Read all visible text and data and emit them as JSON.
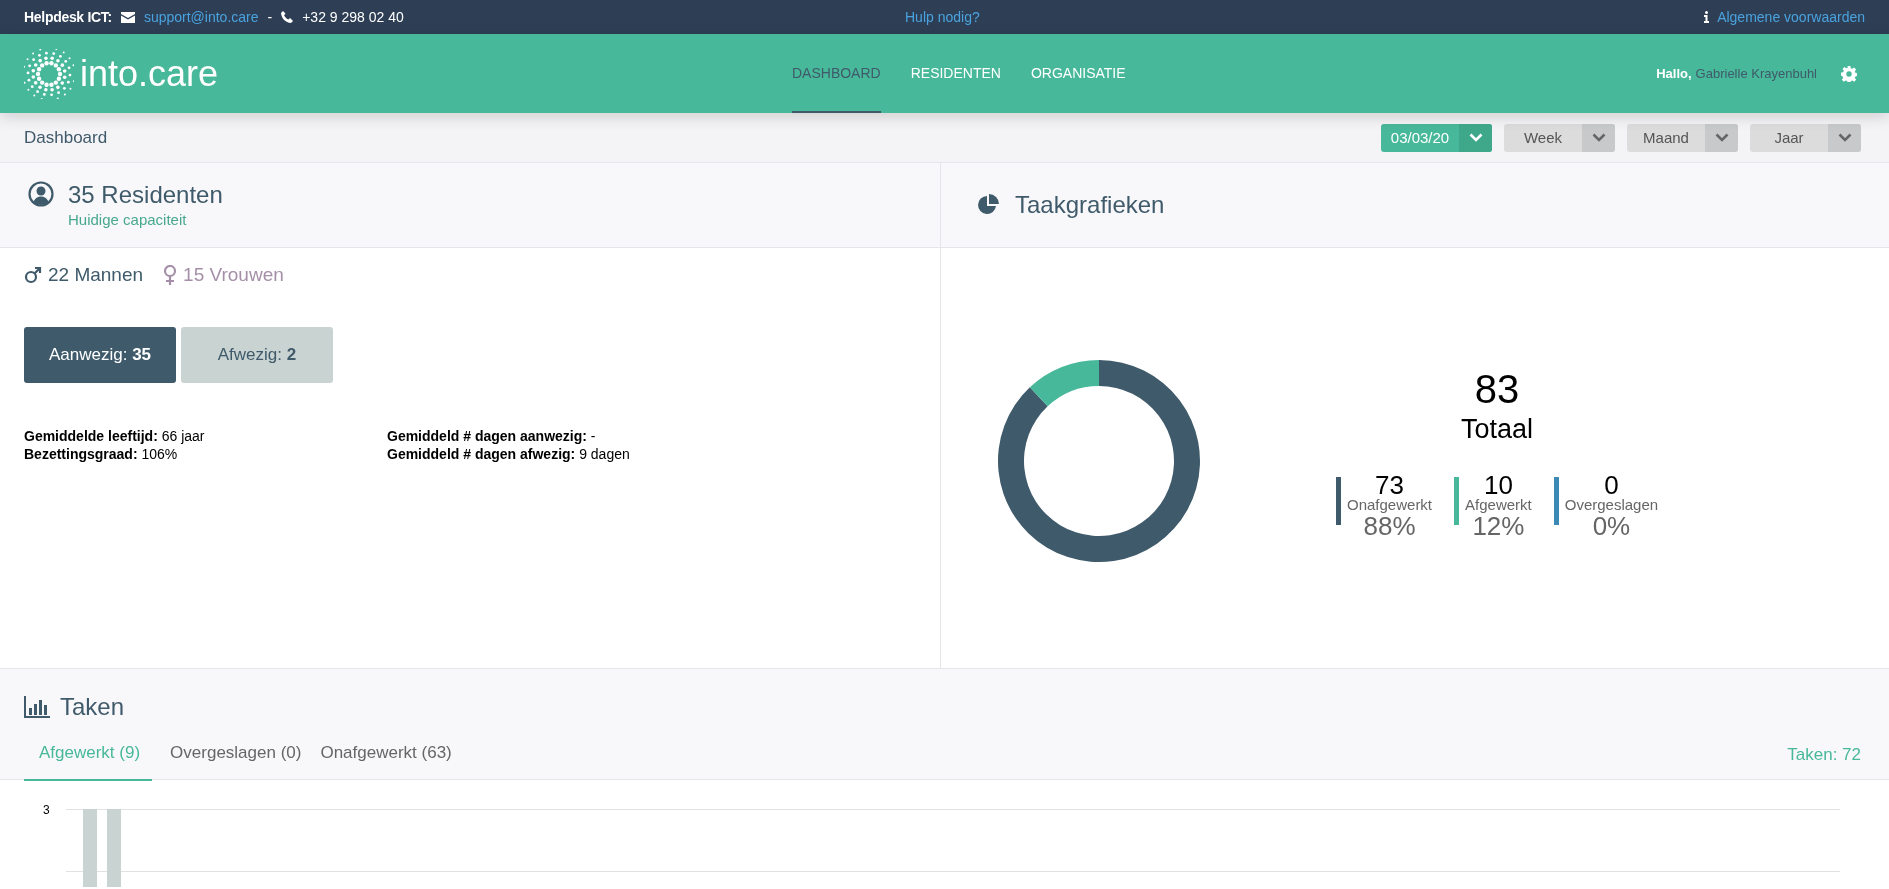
{
  "top_bar": {
    "helpdesk_label": "Helpdesk ICT:",
    "email": "support@into.care",
    "separator": "-",
    "phone": "+32 9 298 02 40",
    "help_link": "Hulp nodig?",
    "terms_link": "Algemene voorwaarden"
  },
  "header": {
    "logo_text": "into.care",
    "nav": [
      {
        "label": "DASHBOARD",
        "selected": true
      },
      {
        "label": "RESIDENTEN",
        "selected": false
      },
      {
        "label": "ORGANISATIE",
        "selected": false
      }
    ],
    "greeting": "Hallo,",
    "user_name": "Gabrielle Krayenbuhl"
  },
  "breadcrumb": "Dashboard",
  "period_selectors": [
    {
      "label": "03/03/20",
      "selected": true
    },
    {
      "label": "Week",
      "selected": false
    },
    {
      "label": "Maand",
      "selected": false
    },
    {
      "label": "Jaar",
      "selected": false
    }
  ],
  "residents": {
    "title": "35 Residenten",
    "subtitle": "Huidige capaciteit",
    "men": "22 Mannen",
    "women": "15 Vrouwen",
    "presence_buttons": [
      {
        "label": "Aanwezig:",
        "count": "35",
        "selected": true
      },
      {
        "label": "Afwezig:",
        "count": "2",
        "selected": false
      }
    ],
    "stats": [
      {
        "label": "Gemiddelde leeftijd:",
        "value": "66 jaar"
      },
      {
        "label": "Bezettingsgraad:",
        "value": "106%"
      },
      {
        "label": "Gemiddeld # dagen aanwezig:",
        "value": "-"
      },
      {
        "label": "Gemiddeld # dagen afwezig:",
        "value": "9 dagen"
      }
    ]
  },
  "task_charts": {
    "title": "Taakgrafieken",
    "total": "83",
    "total_label": "Totaal",
    "chart_data": {
      "type": "donut",
      "values": [
        88,
        12,
        0
      ]
    },
    "legend": [
      {
        "count": "73",
        "label": "Onafgewerkt",
        "percent": "88%",
        "color": "#3f5a6a"
      },
      {
        "count": "10",
        "label": "Afgewerkt",
        "percent": "12%",
        "color": "#48b89a"
      },
      {
        "count": "0",
        "label": "Overgeslagen",
        "percent": "0%",
        "color": "#3a8ab5"
      }
    ]
  },
  "tasks": {
    "title": "Taken",
    "tabs": [
      {
        "label": "Afgewerkt (9)",
        "selected": true
      },
      {
        "label": "Overgeslagen (0)",
        "selected": false
      },
      {
        "label": "Onafgewerkt (63)",
        "selected": false
      }
    ],
    "total": "Taken: 72",
    "y_tick": "3"
  }
}
